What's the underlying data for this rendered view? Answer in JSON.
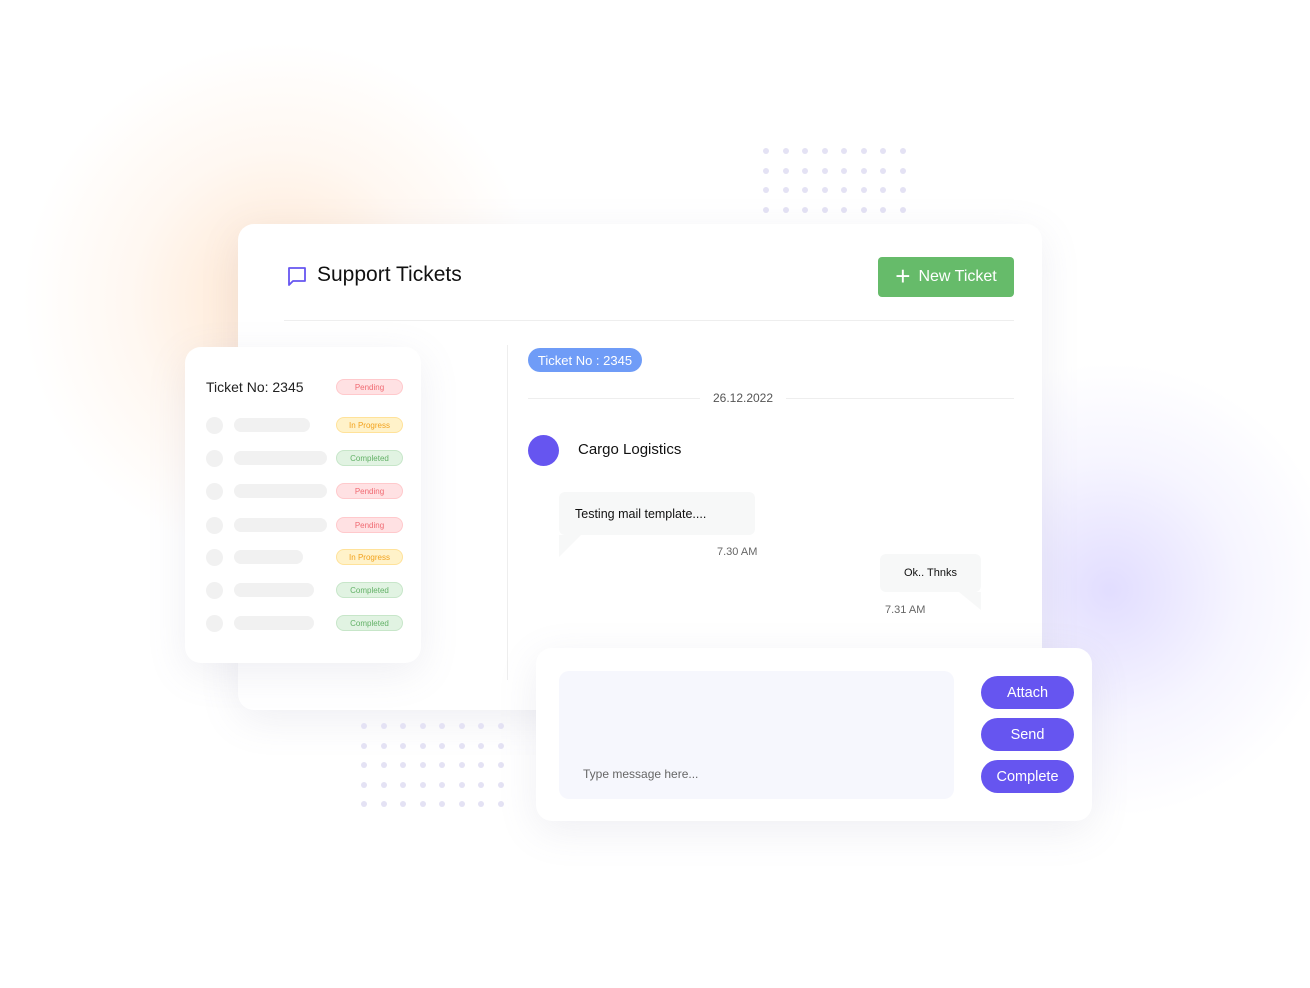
{
  "header": {
    "title": "Support Tickets",
    "new_ticket_label": "New Ticket",
    "title_icon": "chat-bubble-icon",
    "accent": "#6655f0",
    "new_ticket_color": "#66bb6a"
  },
  "ticket_list": {
    "title": "Ticket No: 2345",
    "title_status": "Pending",
    "rows": [
      {
        "status": "In Progress",
        "kind": "progress"
      },
      {
        "status": "Completed",
        "kind": "completed"
      },
      {
        "status": "Pending",
        "kind": "pending"
      },
      {
        "status": "Pending",
        "kind": "pending"
      },
      {
        "status": "In Progress",
        "kind": "progress"
      },
      {
        "status": "Completed",
        "kind": "completed"
      },
      {
        "status": "Completed",
        "kind": "completed"
      }
    ]
  },
  "conversation": {
    "ticket_badge": "Ticket No : 2345",
    "date": "26.12.2022",
    "contact_name": "Cargo Logistics",
    "messages": [
      {
        "text": "Testing mail template....",
        "time": "7.30 AM"
      },
      {
        "text": "Ok.. Thnks",
        "time": "7.31 AM"
      }
    ]
  },
  "composer": {
    "placeholder": "Type message here...",
    "attach_label": "Attach",
    "send_label": "Send",
    "complete_label": "Complete"
  }
}
